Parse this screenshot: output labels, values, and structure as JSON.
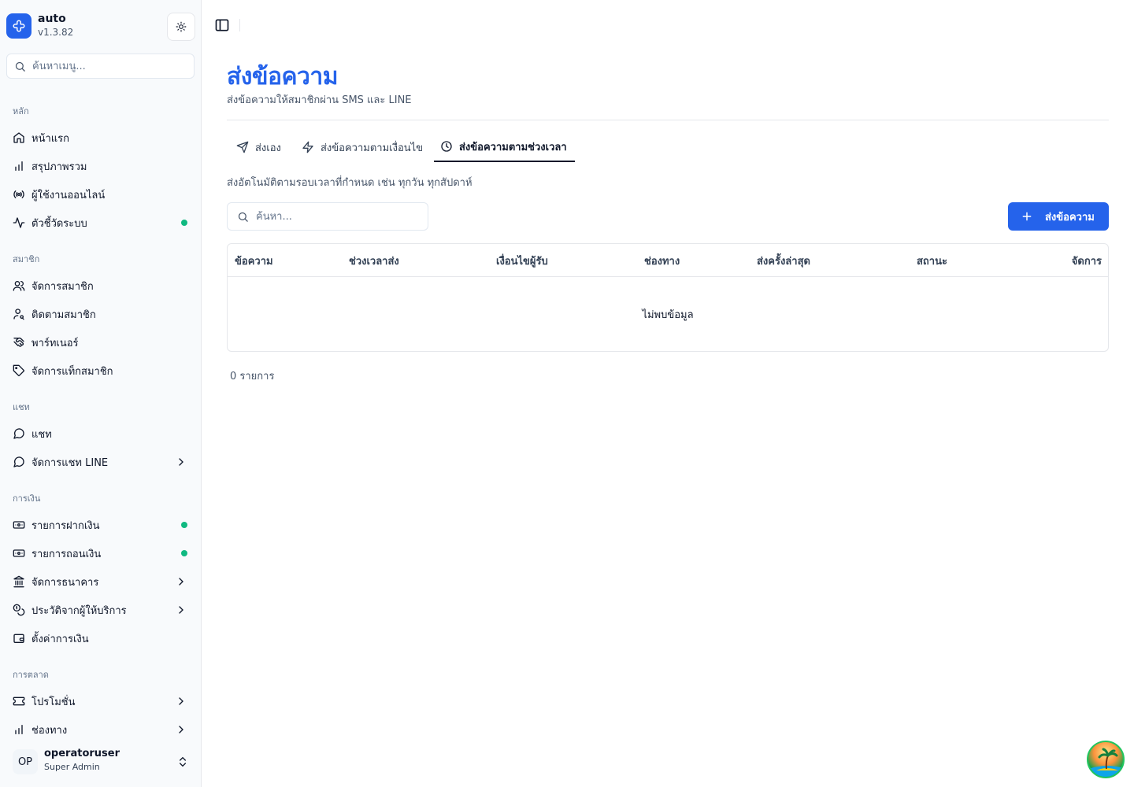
{
  "app": {
    "name": "auto",
    "version": "v1.3.82"
  },
  "sidebar": {
    "search_placeholder": "ค้นหาเมนู...",
    "groups": [
      {
        "label": "หลัก",
        "items": [
          {
            "label": "หน้าแรก",
            "icon": "home-icon"
          },
          {
            "label": "สรุปภาพรวม",
            "icon": "bar-chart-icon"
          },
          {
            "label": "ผู้ใช้งานออนไลน์",
            "icon": "radio-icon"
          },
          {
            "label": "ตัวชี้วัดระบบ",
            "icon": "activity-icon",
            "status_dot": "#10b981"
          }
        ]
      },
      {
        "label": "สมาชิก",
        "items": [
          {
            "label": "จัดการสมาชิก",
            "icon": "users-icon"
          },
          {
            "label": "ติดตามสมาชิก",
            "icon": "user-search-icon"
          },
          {
            "label": "พาร์ทเนอร์",
            "icon": "handshake-icon"
          },
          {
            "label": "จัดการแท็กสมาชิก",
            "icon": "tag-icon"
          }
        ]
      },
      {
        "label": "แชท",
        "items": [
          {
            "label": "แชท",
            "icon": "message-circle-icon"
          },
          {
            "label": "จัดการแชท LINE",
            "icon": "message-circle-icon",
            "has_submenu": true
          }
        ]
      },
      {
        "label": "การเงิน",
        "items": [
          {
            "label": "รายการฝากเงิน",
            "icon": "deposit-icon",
            "status_dot": "#10b981"
          },
          {
            "label": "รายการถอนเงิน",
            "icon": "withdraw-icon",
            "status_dot": "#10b981"
          },
          {
            "label": "จัดการธนาคาร",
            "icon": "bank-icon",
            "has_submenu": true
          },
          {
            "label": "ประวัติจากผู้ให้บริการ",
            "icon": "coins-icon",
            "has_submenu": true
          },
          {
            "label": "ตั้งค่าการเงิน",
            "icon": "wallet-icon"
          }
        ]
      },
      {
        "label": "การตลาด",
        "items": [
          {
            "label": "โปรโมชั่น",
            "icon": "ticket-icon",
            "has_submenu": true
          },
          {
            "label": "ช่องทาง",
            "icon": "bar-chart-icon",
            "has_submenu": true
          }
        ]
      }
    ],
    "user": {
      "initials": "OP",
      "name": "operatoruser",
      "role": "Super Admin"
    }
  },
  "page": {
    "title": "ส่งข้อความ",
    "subtitle": "ส่งข้อความให้สมาชิกผ่าน SMS และ LINE",
    "tabs": [
      {
        "label": "ส่งเอง",
        "icon": "send-icon",
        "active": false
      },
      {
        "label": "ส่งข้อความตามเงื่อนไข",
        "icon": "zap-icon",
        "active": false
      },
      {
        "label": "ส่งข้อความตามช่วงเวลา",
        "icon": "clock-icon",
        "active": true
      }
    ],
    "tab_description": "ส่งอัตโนมัติตามรอบเวลาที่กำหนด เช่น ทุกวัน ทุกสัปดาห์",
    "search_placeholder": "ค้นหา...",
    "primary_button": "ส่งข้อความ",
    "table": {
      "columns": [
        "ข้อความ",
        "ช่วงเวลาส่ง",
        "เงื่อนไขผู้รับ",
        "ช่องทาง",
        "ส่งครั้งล่าสุด",
        "สถานะ",
        "จัดการ"
      ],
      "rows": [],
      "empty_message": "ไม่พบข้อมูล"
    },
    "row_count": "0 รายการ"
  },
  "colors": {
    "accent": "#2563eb",
    "status_online": "#10b981"
  }
}
